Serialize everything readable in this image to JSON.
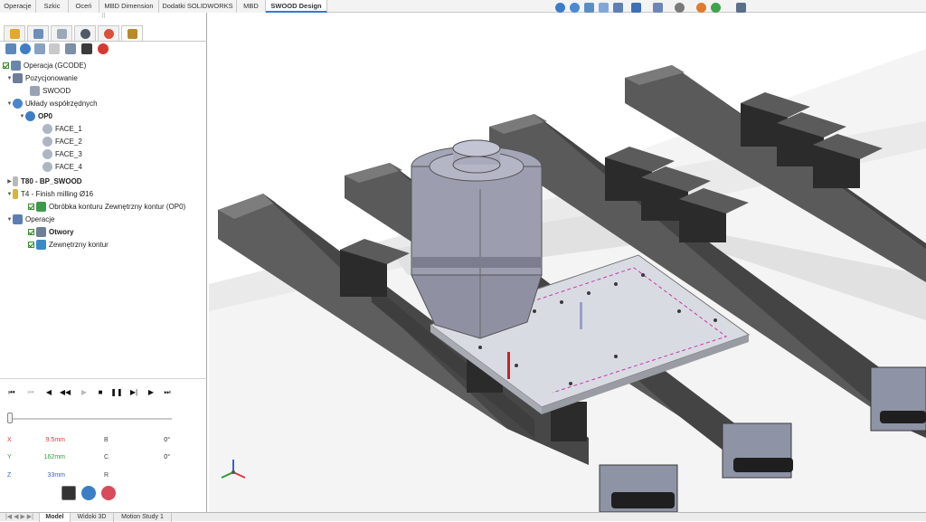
{
  "command_tabs": [
    {
      "label": "Operacje",
      "active": false
    },
    {
      "label": "Szkic",
      "active": false
    },
    {
      "label": "Oceń",
      "active": false
    },
    {
      "label": "MBD Dimension",
      "active": false
    },
    {
      "label": "Dodatki SOLIDWORKS",
      "active": false
    },
    {
      "label": "MBD",
      "active": false
    },
    {
      "label": "SWOOD Design",
      "active": true
    }
  ],
  "hud_icons": [
    "zoom-to-fit-icon",
    "zoom-area-icon",
    "previous-view-icon",
    "section-view-icon",
    "dynamic-annotation-icon",
    "view-orientation-icon",
    "display-style-icon",
    "hide-show-icon",
    "edit-appearance-icon",
    "apply-scene-icon",
    "view-settings-icon"
  ],
  "manager_tabs": [
    "feature-manager-icon",
    "property-manager-icon",
    "configuration-manager-icon",
    "dimxpert-icon",
    "display-manager-icon",
    "swood-cam-icon"
  ],
  "tree_toolbar": [
    "operation-icon",
    "coordinate-icon",
    "edit-icon",
    "stock-icon",
    "tool-library-icon",
    "simulation-icon"
  ],
  "tree": {
    "root": "Operacja (GCODE)",
    "positioning": "Pozycjonowanie",
    "positioning_child": "SWOOD",
    "coordinate_systems": "Układy współrzędnych",
    "op0": "OP0",
    "faces": [
      "FACE_1",
      "FACE_2",
      "FACE_3",
      "FACE_4"
    ],
    "t80": "T80 - BP_SWOOD",
    "t4": "T4 - Finish milling Ø16",
    "t4_child": "Obróbka konturu Zewnętrzny kontur  (OP0)",
    "operations": "Operacje",
    "op_holes": "Otwory",
    "op_contour": "Zewnętrzny kontur"
  },
  "playback": [
    "skip-start-icon",
    "step-back-disabled-icon",
    "step-back-icon",
    "rewind-icon",
    "play-disabled-icon",
    "stop-icon",
    "pause-icon",
    "step-forward-icon",
    "play-forward-icon",
    "skip-end-icon"
  ],
  "playback_glyphs": [
    "⏮",
    "⏮",
    "◀",
    "◀◀",
    "▶",
    "■",
    "❚❚",
    "▶|",
    "▶",
    "⏭"
  ],
  "readout": {
    "x_label": "X",
    "x_value": "9.5mm",
    "y_label": "Y",
    "y_value": "162mm",
    "z_label": "Z",
    "z_value": "33mm",
    "b_label": "B",
    "b_value": "0°",
    "c_label": "C",
    "c_value": "0°",
    "r_label": "R",
    "r_value": ""
  },
  "sim_progress": 0.0,
  "bottom_tabs": [
    {
      "label": "Model",
      "active": true
    },
    {
      "label": "Widoki 3D",
      "active": false
    },
    {
      "label": "Motion Study 1",
      "active": false
    }
  ],
  "colors": {
    "x_axis": "#d93a3a",
    "y_axis": "#2e9e3a",
    "z_axis": "#3a5fd9",
    "accent": "#3b78c6"
  }
}
